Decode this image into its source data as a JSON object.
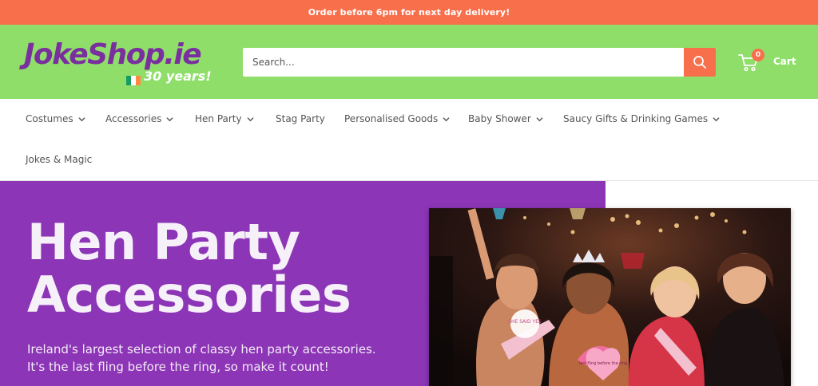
{
  "announcement": "Order before 6pm for next day delivery!",
  "header": {
    "logo_text": "JokeShop.ie",
    "logo_tagline": "30 years!",
    "search_placeholder": "Search...",
    "cart_count": "0",
    "cart_label": "Cart"
  },
  "nav": {
    "items": [
      {
        "label": "Costumes",
        "dropdown": true
      },
      {
        "label": "Accessories",
        "dropdown": true
      },
      {
        "label": "Hen Party",
        "dropdown": true
      },
      {
        "label": "Stag Party",
        "dropdown": false
      },
      {
        "label": "Personalised Goods",
        "dropdown": true
      },
      {
        "label": "Baby Shower",
        "dropdown": true
      },
      {
        "label": "Saucy Gifts & Drinking Games",
        "dropdown": true
      },
      {
        "label": "Jokes & Magic",
        "dropdown": false
      }
    ]
  },
  "hero": {
    "title_line1": "Hen Party",
    "title_line2": "Accessories",
    "subtitle_line1": "Ireland's largest selection of classy hen party accessories.",
    "subtitle_line2": "It's the last fling before the ring, so make it count!",
    "prop_sign_1": "SHE SAID YES",
    "prop_sign_2": "last fling before the ring"
  },
  "colors": {
    "announce_bg": "#f86f4c",
    "header_bg": "#8fde6a",
    "accent": "#f86f4c",
    "hero_bg": "#8c35b6",
    "logo": "#7a2f9e"
  },
  "icons": {
    "search": "search-icon",
    "cart": "cart-icon",
    "chevron": "chevron-down-icon"
  }
}
